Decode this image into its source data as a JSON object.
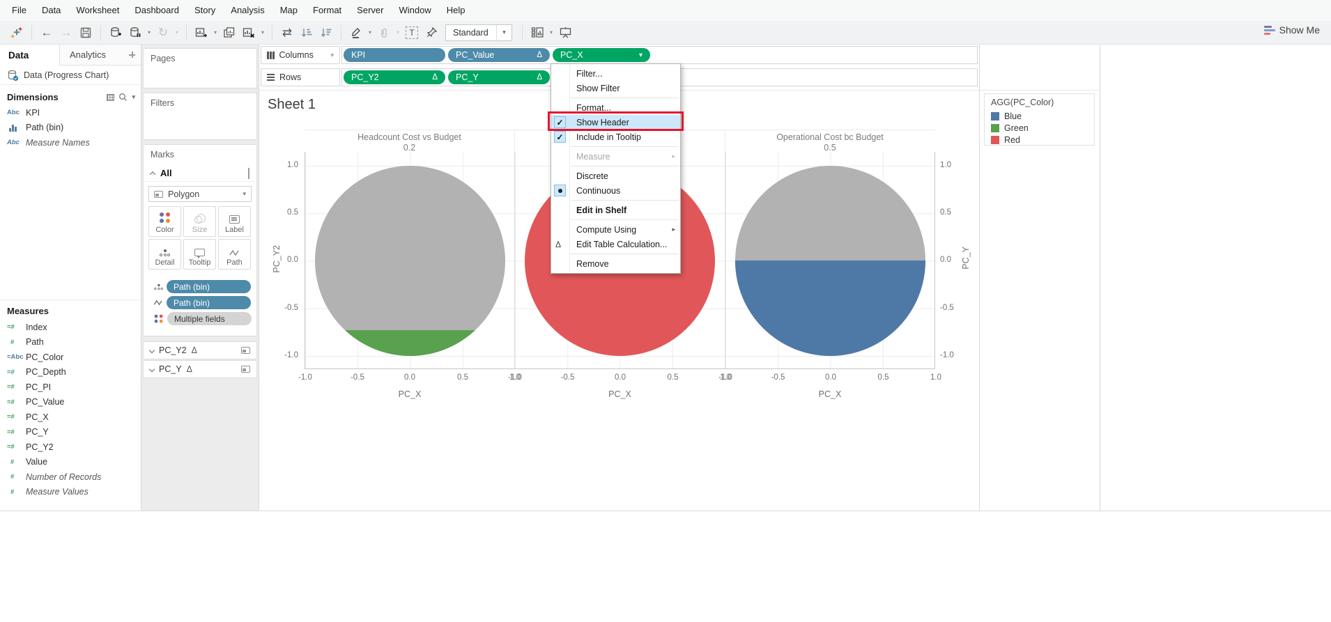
{
  "menu_bar": {
    "items": [
      "File",
      "Data",
      "Worksheet",
      "Dashboard",
      "Story",
      "Analysis",
      "Map",
      "Format",
      "Server",
      "Window",
      "Help"
    ]
  },
  "toolbar": {
    "view_mode": "Standard",
    "show_me_label": "Show Me"
  },
  "icons": {
    "undo": "←",
    "redo": "→",
    "refresh": "↻",
    "swap_axes": "⇄",
    "caret": "▾",
    "submenu_arrow": "▸",
    "delta": "Δ",
    "check": "✓",
    "text_label": "T",
    "sort_down": "↓"
  },
  "sidebar": {
    "tabs": [
      {
        "label": "Data"
      },
      {
        "label": "Analytics"
      }
    ],
    "data_source": {
      "name": "Data (Progress Chart)"
    },
    "dimensions": {
      "header": "Dimensions",
      "items": [
        {
          "label": "KPI",
          "icon": "Abc"
        },
        {
          "label": "Path (bin)",
          "icon": "bin-histogram"
        },
        {
          "label": "Measure Names",
          "icon": "Abc",
          "italic": true
        }
      ]
    },
    "measures": {
      "header": "Measures",
      "items": [
        {
          "label": "Index",
          "icon": "=#"
        },
        {
          "label": "Path",
          "icon": "#"
        },
        {
          "label": "PC_Color",
          "icon": "=Abc"
        },
        {
          "label": "PC_Depth",
          "icon": "=#"
        },
        {
          "label": "PC_PI",
          "icon": "=#"
        },
        {
          "label": "PC_Value",
          "icon": "=#"
        },
        {
          "label": "PC_X",
          "icon": "=#"
        },
        {
          "label": "PC_Y",
          "icon": "=#"
        },
        {
          "label": "PC_Y2",
          "icon": "=#"
        },
        {
          "label": "Value",
          "icon": "#"
        },
        {
          "label": "Number of Records",
          "icon": "#",
          "italic": true
        },
        {
          "label": "Measure Values",
          "icon": "#",
          "italic": true
        }
      ]
    }
  },
  "cards": {
    "pages_label": "Pages",
    "filters_label": "Filters",
    "marks_label": "Marks",
    "marks_all_label": "All",
    "mark_type": "Polygon",
    "mark_buttons": [
      {
        "label": "Color"
      },
      {
        "label": "Size"
      },
      {
        "label": "Label"
      },
      {
        "label": "Detail"
      },
      {
        "label": "Tooltip"
      },
      {
        "label": "Path"
      }
    ],
    "mark_pills": [
      {
        "label": "Path (bin)",
        "style": "blue",
        "icon": "detail-dots"
      },
      {
        "label": "Path (bin)",
        "style": "blue",
        "icon": "path-zigzag"
      },
      {
        "label": "Multiple fields",
        "style": "gray",
        "icon": "color-dots"
      }
    ],
    "measure_cards": [
      {
        "label": "PC_Y2",
        "delta": "Δ"
      },
      {
        "label": "PC_Y",
        "delta": "Δ"
      }
    ]
  },
  "shelves": {
    "columns_label": "Columns",
    "rows_label": "Rows",
    "columns_pills": [
      {
        "label": "KPI",
        "style": "blue"
      },
      {
        "label": "PC_Value",
        "style": "blue",
        "delta": "Δ"
      },
      {
        "label": "PC_X",
        "style": "green",
        "caret": "▾"
      }
    ],
    "rows_pills": [
      {
        "label": "PC_Y2",
        "style": "green",
        "delta": "Δ"
      },
      {
        "label": "PC_Y",
        "style": "green",
        "delta": "Δ"
      }
    ]
  },
  "sheet": {
    "title": "Sheet 1"
  },
  "context_menu": {
    "items": [
      {
        "label": "Filter..."
      },
      {
        "label": "Show Filter"
      },
      {
        "label": "Format..."
      },
      {
        "label": "Show Header",
        "checked": true,
        "highlighted": true,
        "annotated": true
      },
      {
        "label": "Include in Tooltip",
        "checked": true
      },
      {
        "label": "Measure",
        "disabled": true,
        "submenu": true
      },
      {
        "label": "Discrete"
      },
      {
        "label": "Continuous",
        "radio_selected": true
      },
      {
        "label": "Edit in Shelf",
        "bold": true
      },
      {
        "label": "Compute Using",
        "submenu": true
      },
      {
        "label": "Edit Table Calculation...",
        "delta_icon": true
      },
      {
        "label": "Remove"
      }
    ]
  },
  "legend": {
    "title": "AGG(PC_Color)",
    "items": [
      {
        "label": "Blue",
        "color": "#4e79a7"
      },
      {
        "label": "Green",
        "color": "#59a14f"
      },
      {
        "label": "Red",
        "color": "#e15759"
      }
    ]
  },
  "chart_data": {
    "type": "progress-circles",
    "sheet_title": "Sheet 1",
    "panes": [
      {
        "title": "Headcount Cost vs Budget",
        "value_label": "0.2",
        "base_color": "#b2b2b2",
        "fill_color": "#59a14f",
        "fill_value": 0.2
      },
      {
        "title": "",
        "value_label": "",
        "base_color": "#e15759",
        "fill_color": "#e15759",
        "fill_value": 1.0
      },
      {
        "title": "Operational Cost bc Budget",
        "value_label": "0.5",
        "base_color": "#b2b2b2",
        "fill_color": "#4e79a7",
        "fill_value": 0.5
      }
    ],
    "x_ticks": [
      "-1.0",
      "-0.5",
      "0.0",
      "0.5",
      "1.0"
    ],
    "y_ticks": [
      "1.0",
      "0.5",
      "0.0",
      "-0.5",
      "-1.0"
    ],
    "x_axis_label": "PC_X",
    "left_axis_label": "PC_Y2",
    "right_axis_label": "PC_Y",
    "x_range": [
      -1.0,
      1.0
    ],
    "y_range": [
      -1.0,
      1.0
    ]
  },
  "colors": {
    "pill_blue": "#4e8aa9",
    "pill_green": "#00a564",
    "circle_gray": "#b2b2b2",
    "circle_red": "#e15759",
    "circle_blue": "#4e79a7",
    "circle_green": "#59a14f",
    "menu_highlight": "#cde8fb",
    "annotation_red": "#e8112d"
  }
}
